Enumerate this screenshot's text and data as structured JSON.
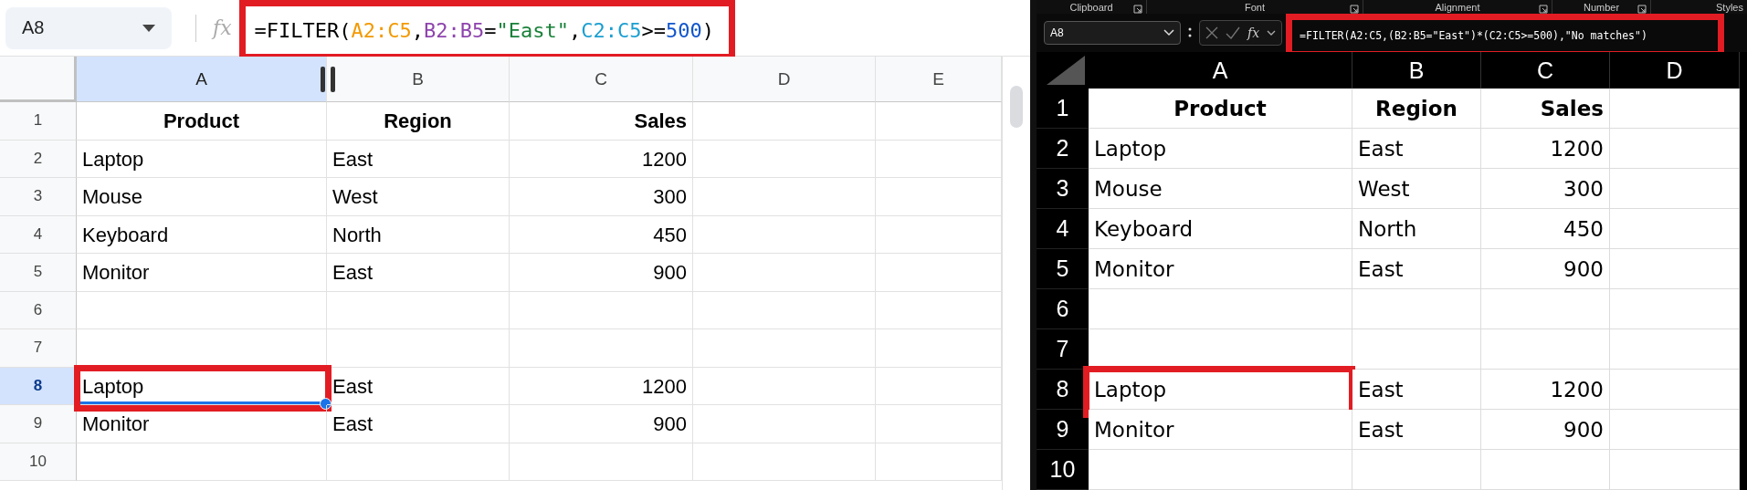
{
  "google_sheets": {
    "name_box": "A8",
    "fx": "fx",
    "formula_bar": {
      "highlighted": true,
      "tokens": [
        {
          "text": "=FILTER(",
          "color": "#000000"
        },
        {
          "text": "A2:C5",
          "color": "#f29900"
        },
        {
          "text": ",",
          "color": "#000000"
        },
        {
          "text": "B2:B5",
          "color": "#8e44ad"
        },
        {
          "text": "=",
          "color": "#000000"
        },
        {
          "text": "\"East\"",
          "color": "#188038"
        },
        {
          "text": ",",
          "color": "#000000"
        },
        {
          "text": "C2:C5",
          "color": "#1a9fd0"
        },
        {
          "text": ">=",
          "color": "#000000"
        },
        {
          "text": "500",
          "color": "#1155cc"
        },
        {
          "text": ")",
          "color": "#000000"
        }
      ]
    },
    "columns": [
      {
        "label": "A",
        "selected": true
      },
      {
        "label": "B",
        "selected": false
      },
      {
        "label": "C",
        "selected": false
      },
      {
        "label": "D",
        "selected": false
      },
      {
        "label": "E",
        "selected": false
      }
    ],
    "rows": [
      {
        "number": "1",
        "kind": "header",
        "selected": false,
        "highlighted": false,
        "cells": [
          "Product",
          "Region",
          "Sales"
        ]
      },
      {
        "number": "2",
        "kind": "data",
        "selected": false,
        "highlighted": false,
        "cells": [
          "Laptop",
          "East",
          "1200"
        ]
      },
      {
        "number": "3",
        "kind": "data",
        "selected": false,
        "highlighted": false,
        "cells": [
          "Mouse",
          "West",
          "300"
        ]
      },
      {
        "number": "4",
        "kind": "data",
        "selected": false,
        "highlighted": false,
        "cells": [
          "Keyboard",
          "North",
          "450"
        ]
      },
      {
        "number": "5",
        "kind": "data",
        "selected": false,
        "highlighted": false,
        "cells": [
          "Monitor",
          "East",
          "900"
        ]
      },
      {
        "number": "6",
        "kind": "data",
        "selected": false,
        "highlighted": false
      },
      {
        "number": "7",
        "kind": "data",
        "selected": false,
        "highlighted": false
      },
      {
        "number": "8",
        "kind": "data",
        "selected": true,
        "highlighted": true,
        "cells": [
          "Laptop",
          "East",
          "1200"
        ]
      },
      {
        "number": "9",
        "kind": "data",
        "selected": false,
        "highlighted": false,
        "cells": [
          "Monitor",
          "East",
          "900"
        ]
      },
      {
        "number": "10",
        "kind": "data",
        "selected": false,
        "highlighted": false
      }
    ]
  },
  "excel": {
    "ribbon_groups": [
      "Clipboard",
      "Font",
      "Alignment",
      "Number",
      "Styles"
    ],
    "name_box": "A8",
    "fx": "fx",
    "formula_bar": {
      "highlighted": true,
      "text": "=FILTER(A2:C5,(B2:B5=\"East\")*(C2:C5>=500),\"No matches\")"
    },
    "columns": [
      "A",
      "B",
      "C",
      "D"
    ],
    "rows": [
      {
        "number": "1",
        "kind": "header",
        "highlighted": false,
        "cells": [
          "Product",
          "Region",
          "Sales"
        ]
      },
      {
        "number": "2",
        "kind": "data",
        "highlighted": false,
        "cells": [
          "Laptop",
          "East",
          "1200"
        ]
      },
      {
        "number": "3",
        "kind": "data",
        "highlighted": false,
        "cells": [
          "Mouse",
          "West",
          "300"
        ]
      },
      {
        "number": "4",
        "kind": "data",
        "highlighted": false,
        "cells": [
          "Keyboard",
          "North",
          "450"
        ]
      },
      {
        "number": "5",
        "kind": "data",
        "highlighted": false,
        "cells": [
          "Monitor",
          "East",
          "900"
        ]
      },
      {
        "number": "6",
        "kind": "data",
        "highlighted": false
      },
      {
        "number": "7",
        "kind": "data",
        "highlighted": false
      },
      {
        "number": "8",
        "kind": "data",
        "highlighted": true,
        "cells": [
          "Laptop",
          "East",
          "1200"
        ]
      },
      {
        "number": "9",
        "kind": "data",
        "highlighted": false,
        "cells": [
          "Monitor",
          "East",
          "900"
        ]
      },
      {
        "number": "10",
        "kind": "data",
        "highlighted": false
      }
    ]
  }
}
